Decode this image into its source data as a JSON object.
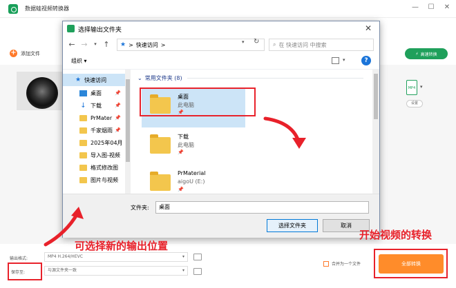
{
  "app": {
    "title": "数据蛙视频转换器",
    "min_glyph": "—",
    "max_glyph": "☐",
    "close_glyph": "✕"
  },
  "toolbar": {
    "add_file_label": "添加文件",
    "high_speed_label": "高速转换"
  },
  "format_card": {
    "format_icon_label": "MP4",
    "settings_label": "设置"
  },
  "bottom": {
    "output_format_label": "输出格式:",
    "output_format_value": "MP4 H.264/HEVC",
    "save_to_label": "保存至:",
    "save_to_value": "与源文件夹一致",
    "merge_label": "合并为一个文件",
    "start_button_label": "全部转换"
  },
  "dialog": {
    "title": "选择输出文件夹",
    "close_glyph": "✕",
    "address": "快速访问",
    "address_sep": ">",
    "search_placeholder": "在 快速访问 中搜索",
    "organize_label": "组织 ▾",
    "help_glyph": "?",
    "nav": {
      "quick_access": "快速访问",
      "items": [
        {
          "label": "桌面"
        },
        {
          "label": "下载"
        },
        {
          "label": "PrMater"
        },
        {
          "label": "千家烟雨"
        },
        {
          "label": "2025年04月"
        },
        {
          "label": "导入图-视频"
        },
        {
          "label": "格式修改图"
        },
        {
          "label": "图片与视频"
        }
      ]
    },
    "group_header": "常用文件夹 (8)",
    "folders": [
      {
        "name": "桌面",
        "sub": "此电脑",
        "pin": "📌"
      },
      {
        "name": "下载",
        "sub": "此电脑",
        "pin": "📌"
      },
      {
        "name": "PrMaterial",
        "sub": "aigoU (E:)",
        "pin": "📌"
      }
    ],
    "filename_label": "文件夹:",
    "filename_value": "桌面",
    "select_button": "选择文件夹",
    "cancel_button": "取消"
  },
  "annotations": {
    "choose_location": "可选择新的输出位置",
    "start_conversion": "开始视频的转换"
  },
  "colors": {
    "accent_green": "#1fa05b",
    "accent_orange": "#ff8c2a",
    "annotation_red": "#e8212a",
    "selection_blue": "#cce4f7"
  }
}
